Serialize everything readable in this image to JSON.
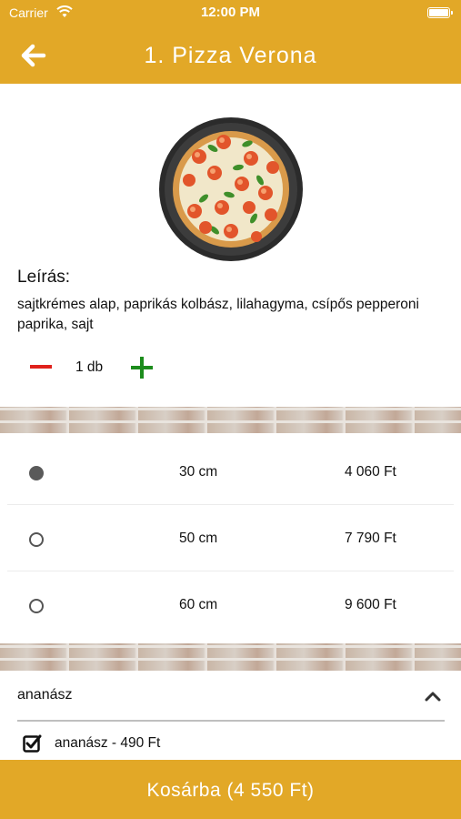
{
  "status_bar": {
    "carrier": "Carrier",
    "time": "12:00 PM"
  },
  "header": {
    "title": "1. Pizza Verona",
    "back_icon": "arrow-left-icon"
  },
  "product": {
    "image": "pizza-image",
    "description_label": "Leírás:",
    "description": "sajtkrémes alap, paprikás kolbász, lilahagyma, csípős pepperoni paprika, sajt"
  },
  "quantity": {
    "value": "1 db"
  },
  "sizes": [
    {
      "size": "30 cm",
      "price": "4 060 Ft",
      "selected": true
    },
    {
      "size": "50 cm",
      "price": "7 790 Ft",
      "selected": false
    },
    {
      "size": "60 cm",
      "price": "9 600 Ft",
      "selected": false
    }
  ],
  "extras": {
    "group_title": "ananász",
    "items": [
      {
        "label": "ananász - 490 Ft",
        "checked": true
      }
    ]
  },
  "cart": {
    "label": "Kosárba (4 550 Ft)"
  },
  "colors": {
    "accent": "#E2A827",
    "minus": "#E0211C",
    "plus": "#1C8C1C"
  }
}
